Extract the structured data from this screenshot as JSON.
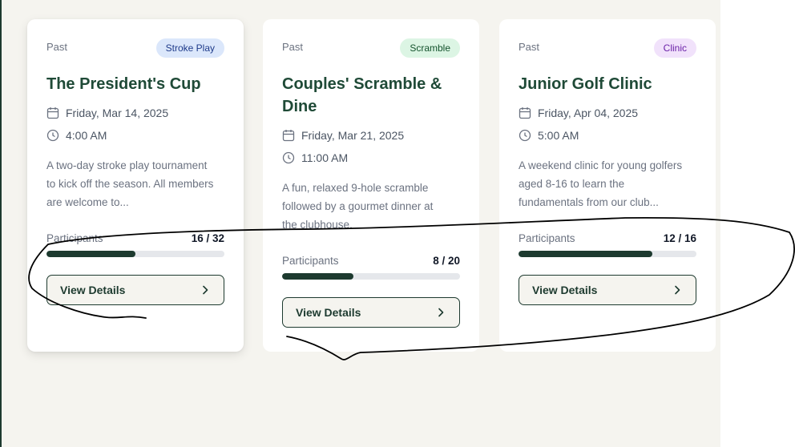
{
  "events": [
    {
      "status": "Past",
      "badge": {
        "label": "Stroke Play",
        "bg": "#dbe7fb",
        "color": "#1e3a8a"
      },
      "title_lines": [
        "The President's Cup"
      ],
      "date": "Friday, Mar 14, 2025",
      "time": "4:00 AM",
      "description_lines": [
        "A two-day stroke play tournament",
        "to kick off the season. All members",
        "are welcome to..."
      ],
      "participants_label": "Participants",
      "participants_count": "16 / 32",
      "participants_fraction": 0.5,
      "button_label": "View Details"
    },
    {
      "status": "Past",
      "badge": {
        "label": "Scramble",
        "bg": "#dcf5e4",
        "color": "#14532d"
      },
      "title_lines": [
        "Couples' Scramble &",
        "Dine"
      ],
      "date": "Friday, Mar 21, 2025",
      "time": "11:00 AM",
      "description_lines": [
        "A fun, relaxed 9-hole scramble",
        "followed by a gourmet dinner at",
        "the clubhouse."
      ],
      "participants_label": "Participants",
      "participants_count": "8 / 20",
      "participants_fraction": 0.4,
      "button_label": "View Details"
    },
    {
      "status": "Past",
      "badge": {
        "label": "Clinic",
        "bg": "#f1e2fb",
        "color": "#6b21a8"
      },
      "title_lines": [
        "Junior Golf Clinic"
      ],
      "date": "Friday, Apr 04, 2025",
      "time": "5:00 AM",
      "description_lines": [
        "A weekend clinic for young golfers",
        "aged 8-16 to learn the",
        "fundamentals from our club..."
      ],
      "participants_label": "Participants",
      "participants_count": "12 / 16",
      "participants_fraction": 0.75,
      "button_label": "View Details"
    }
  ],
  "colors": {
    "accent": "#1d3a2f",
    "title": "#1f4a37",
    "background": "#f5f4ef",
    "bar_track": "#e5e7eb"
  },
  "icons": [
    "calendar-icon",
    "clock-icon",
    "chevron-right-icon"
  ]
}
